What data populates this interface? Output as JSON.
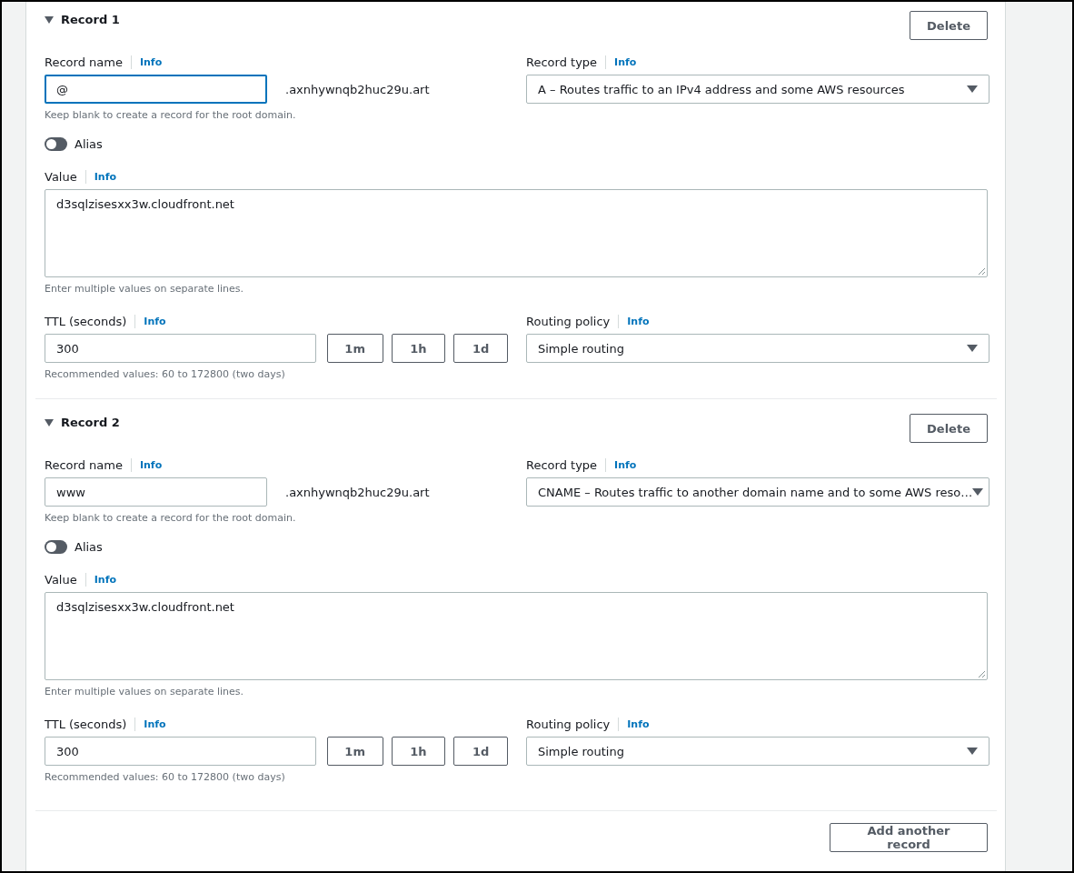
{
  "records": [
    {
      "title": "Record 1",
      "expanded": true,
      "delete_button": "Delete",
      "record_name": {
        "label": "Record name",
        "info": "Info",
        "value": "@",
        "focused": true,
        "suffix": ".axnhywnqb2huc29u.art",
        "hint": "Keep blank to create a record for the root domain."
      },
      "record_type": {
        "label": "Record type",
        "info": "Info",
        "value": "A – Routes traffic to an IPv4 address and some AWS resources"
      },
      "alias": {
        "label": "Alias",
        "on": false
      },
      "value": {
        "label": "Value",
        "info": "Info",
        "value": "d3sqlzisesxx3w.cloudfront.net",
        "hint": "Enter multiple values on separate lines."
      },
      "ttl": {
        "label": "TTL (seconds)",
        "info": "Info",
        "value": "300",
        "presets": [
          "1m",
          "1h",
          "1d"
        ],
        "hint": "Recommended values: 60 to 172800 (two days)"
      },
      "routing_policy": {
        "label": "Routing policy",
        "info": "Info",
        "value": "Simple routing"
      }
    },
    {
      "title": "Record 2",
      "expanded": true,
      "delete_button": "Delete",
      "record_name": {
        "label": "Record name",
        "info": "Info",
        "value": "www",
        "focused": false,
        "suffix": ".axnhywnqb2huc29u.art",
        "hint": "Keep blank to create a record for the root domain."
      },
      "record_type": {
        "label": "Record type",
        "info": "Info",
        "value": "CNAME – Routes traffic to another domain name and to some AWS reso…"
      },
      "alias": {
        "label": "Alias",
        "on": false
      },
      "value": {
        "label": "Value",
        "info": "Info",
        "value": "d3sqlzisesxx3w.cloudfront.net",
        "hint": "Enter multiple values on separate lines."
      },
      "ttl": {
        "label": "TTL (seconds)",
        "info": "Info",
        "value": "300",
        "presets": [
          "1m",
          "1h",
          "1d"
        ],
        "hint": "Recommended values: 60 to 172800 (two days)"
      },
      "routing_policy": {
        "label": "Routing policy",
        "info": "Info",
        "value": "Simple routing"
      }
    }
  ],
  "add_button": "Add another record"
}
